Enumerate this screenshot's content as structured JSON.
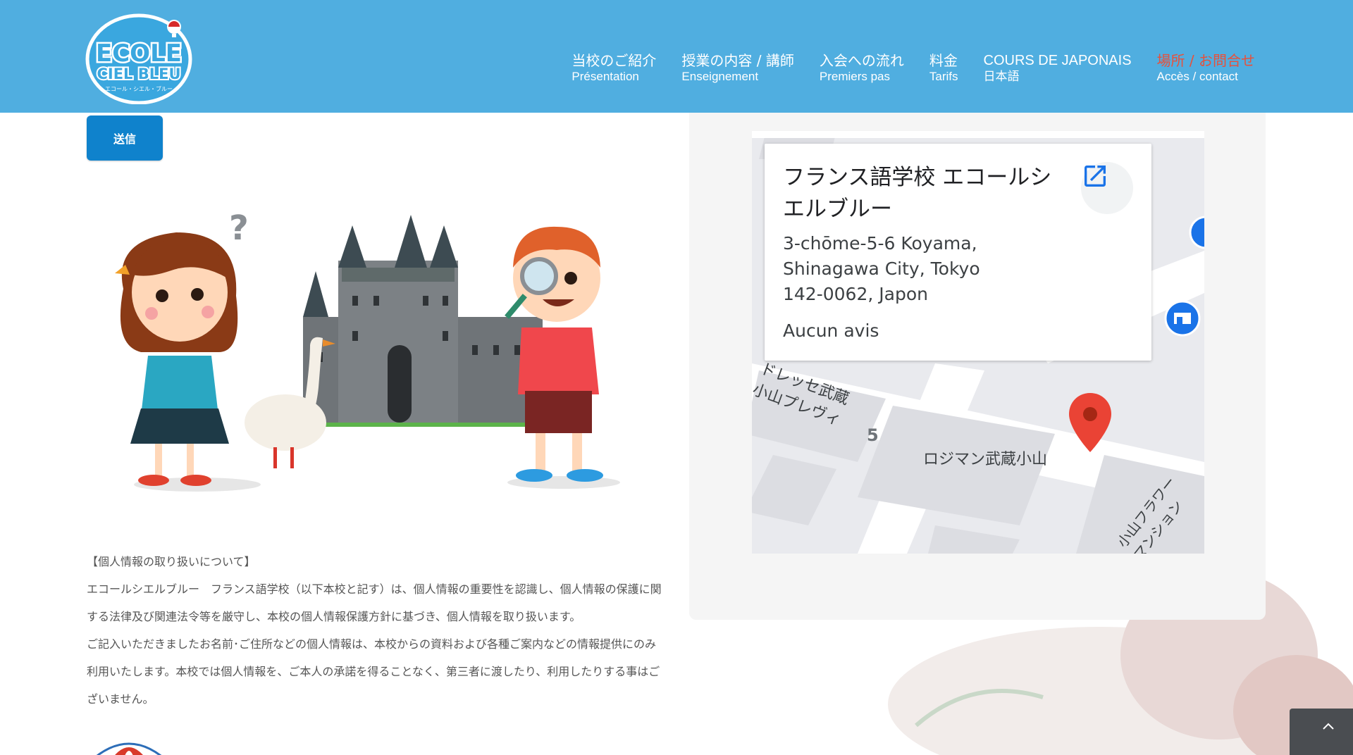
{
  "header": {
    "logo": {
      "line1": "ECOLE",
      "line2": "CIEL BLEU",
      "tagline": "エコール・シエル・ブルー",
      "icon": "balloon-icon"
    },
    "nav": [
      {
        "jp": "当校のご紹介",
        "fr": "Présentation"
      },
      {
        "jp": "授業の内容 / 講師",
        "fr": "Enseignement"
      },
      {
        "jp": "入会への流れ",
        "fr": "Premiers pas"
      },
      {
        "jp": "料金",
        "fr": "Tarifs"
      },
      {
        "jp": "COURS DE JAPONAIS",
        "fr": "日本語"
      },
      {
        "jp": "場所 / お問合せ",
        "fr": "Accès / contact"
      }
    ],
    "active_color": "#e8503a",
    "bg_color": "#50aee0"
  },
  "form": {
    "submit_label": "送信"
  },
  "privacy": {
    "heading": "【個人情報の取り扱いについて】",
    "para1": "エコールシエルブルー　フランス語学校（以下本校と記す）は、個人情報の重要性を認識し、個人情報の保護に関する法律及び関連法令等を厳守し、本校の個人情報保護方針に基づき、個人情報を取り扱います。",
    "para2": "ご記入いただきましたお名前･ご住所などの個人情報は、本校からの資料および各種ご案内などの情報提供にのみ利用いたします。本校では個人情報を、ご本人の承諾を得ることなく、第三者に渡したり、利用したりする事はございません。"
  },
  "map": {
    "place_name": "フランス語学校 エコールシエルブルー",
    "address_line1": "3-chōme-5-6 Koyama,",
    "address_line2": "Shinagawa City, Tokyo",
    "address_line3": "142-0062, Japon",
    "reviews": "Aucun avis",
    "labels": {
      "building1_line1": "ドレッセ武蔵",
      "building1_line2": "小山プレヴィ",
      "block_number": "5",
      "building2": "ロジマン武蔵小山",
      "building3_line1": "小山フラワー",
      "building3_line2": "マンション"
    },
    "pin_color": "#ea4335"
  },
  "back_to_top": {
    "icon": "chevron-up-icon"
  }
}
